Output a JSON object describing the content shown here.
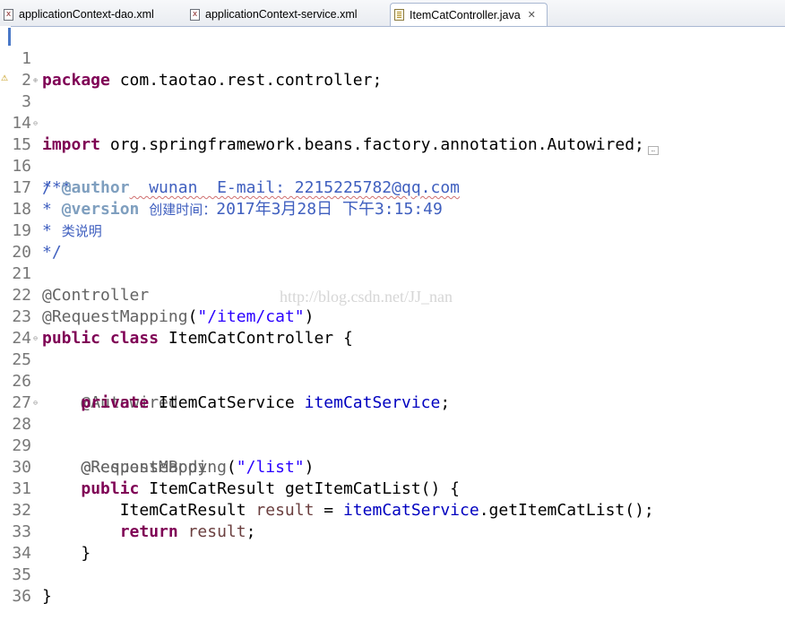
{
  "tabs": [
    {
      "label": "applicationContext-dao.xml",
      "icon": "xml-file-icon",
      "active": false
    },
    {
      "label": "applicationContext-service.xml",
      "icon": "xml-file-icon",
      "active": false
    },
    {
      "label": "ItemCatController.java",
      "icon": "java-file-icon",
      "active": true,
      "close": "✕"
    }
  ],
  "colors": {
    "keyword": "#7f0055",
    "annotation": "#646464",
    "string": "#2a00ff",
    "field": "#0000c0",
    "local_variable": "#6a3e3e",
    "javadoc": "#3f5fbf",
    "javadoc_tag": "#7f9fbf",
    "line_number": "#787878"
  },
  "editor": {
    "lines": {
      "l1": {
        "num": "1",
        "kw": "package",
        "rest": " com.taotao.rest.controller;"
      },
      "l2": {
        "num": "2"
      },
      "l3": {
        "num": "3",
        "kw": "import",
        "rest": " org.springframework.beans.factory.annotation.Autowired;"
      },
      "l14": {
        "num": "14"
      },
      "l15": {
        "num": "15",
        "doc": "/**"
      },
      "l16": {
        "num": "16",
        "star": "* ",
        "tag": "@author",
        "rest": "  wunan  E-mail: 2215225782@qq.com"
      },
      "l17": {
        "num": "17",
        "star": "* ",
        "tag": "@version",
        "cn": "创建时间：",
        "rest": "2017年3月28日 下午3:15:49"
      },
      "l18": {
        "num": "18",
        "star": "* ",
        "cn": "类说明"
      },
      "l19": {
        "num": "19",
        "doc": "*/"
      },
      "l20": {
        "num": "20"
      },
      "l21": {
        "num": "21",
        "ann": "@Controller"
      },
      "l22": {
        "num": "22",
        "ann": "@RequestMapping",
        "open": "(",
        "str": "\"/item/cat\"",
        "close": ")"
      },
      "l23": {
        "num": "23",
        "kw1": "public",
        "kw2": "class",
        "rest": " ItemCatController {"
      },
      "l24": {
        "num": "24"
      },
      "l25": {
        "num": "25",
        "indent": "    ",
        "ann": "@Autowired"
      },
      "l26": {
        "num": "26",
        "indent": "    ",
        "kw": "private",
        "type": " ItemCatService ",
        "field": "itemCatService",
        "end": ";"
      },
      "l27": {
        "num": "27"
      },
      "l28": {
        "num": "28",
        "indent": "    ",
        "ann": "@RequestMapping",
        "open": "(",
        "str": "\"/list\"",
        "close": ")"
      },
      "l29": {
        "num": "29",
        "indent": "    ",
        "ann": "@ResponseBody"
      },
      "l30": {
        "num": "30",
        "indent": "    ",
        "kw": "public",
        "rest": " ItemCatResult getItemCatList() {"
      },
      "l31": {
        "num": "31",
        "indent": "        ",
        "type": "ItemCatResult ",
        "local": "result",
        "eq": " = ",
        "field": "itemCatService",
        "end": ".getItemCatList();"
      },
      "l32": {
        "num": "32",
        "indent": "        ",
        "kw": "return",
        "space": " ",
        "local": "result",
        "end": ";"
      },
      "l33": {
        "num": "33",
        "rest": "    }"
      },
      "l34": {
        "num": "34"
      },
      "l35": {
        "num": "35",
        "rest": "}"
      },
      "l36": {
        "num": "36"
      }
    }
  },
  "watermark": "http://blog.csdn.net/JJ_nan"
}
